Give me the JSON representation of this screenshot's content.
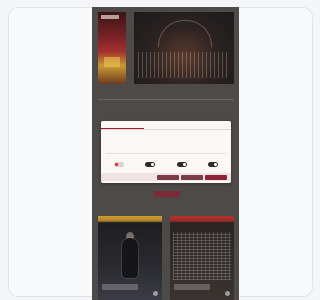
{
  "colors": {
    "page_background": "#f3f5f8",
    "phone_background": "#4d4a48",
    "accent": "#9c1f31",
    "dialog_background": "#fbf7f5"
  },
  "app": {
    "section_label": "",
    "featured_title": ""
  },
  "cookie_dialog": {
    "tabs": [
      {
        "label": "",
        "active": true
      },
      {
        "label": "",
        "active": false
      },
      {
        "label": "",
        "active": false
      }
    ],
    "title": "",
    "body": "",
    "toggles": [
      {
        "label": "",
        "on": true
      },
      {
        "label": "",
        "on": false
      },
      {
        "label": "",
        "on": false
      },
      {
        "label": "",
        "on": false
      }
    ],
    "buttons": [
      {
        "label": "",
        "style": "secondary"
      },
      {
        "label": "",
        "style": "secondary"
      },
      {
        "label": "",
        "style": "primary"
      }
    ]
  },
  "cards": [
    {
      "caption": "",
      "icon": "arrow-circle-icon"
    },
    {
      "caption": "",
      "icon": "arrow-circle-icon"
    }
  ]
}
